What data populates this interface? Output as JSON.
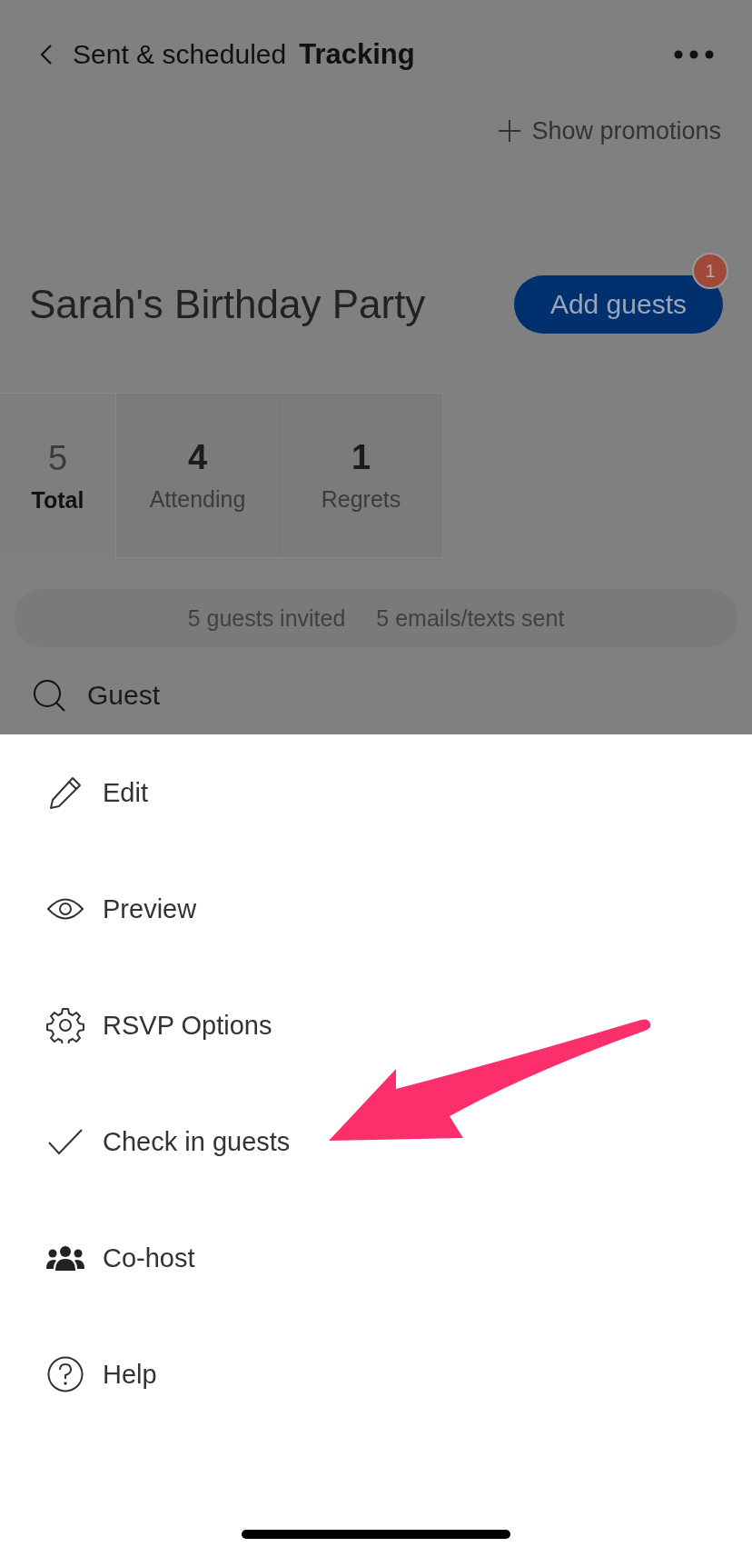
{
  "header": {
    "back_label": "Sent & scheduled",
    "title": "Tracking"
  },
  "promotions_link": "Show promotions",
  "event": {
    "title": "Sarah's Birthday Party",
    "add_button": "Add guests",
    "badge": "1"
  },
  "stat_tabs": [
    {
      "value": "5",
      "label": "Total",
      "selected": true
    },
    {
      "value": "4",
      "label": "Attending",
      "selected": false
    },
    {
      "value": "1",
      "label": "Regrets",
      "selected": false
    }
  ],
  "summary": [
    "5 guests invited",
    "5 emails/texts sent"
  ],
  "search": {
    "placeholder": "Guest"
  },
  "menu": [
    {
      "label": "Edit"
    },
    {
      "label": "Preview"
    },
    {
      "label": "RSVP Options"
    },
    {
      "label": "Check in guests"
    },
    {
      "label": "Co-host"
    },
    {
      "label": "Help"
    }
  ]
}
